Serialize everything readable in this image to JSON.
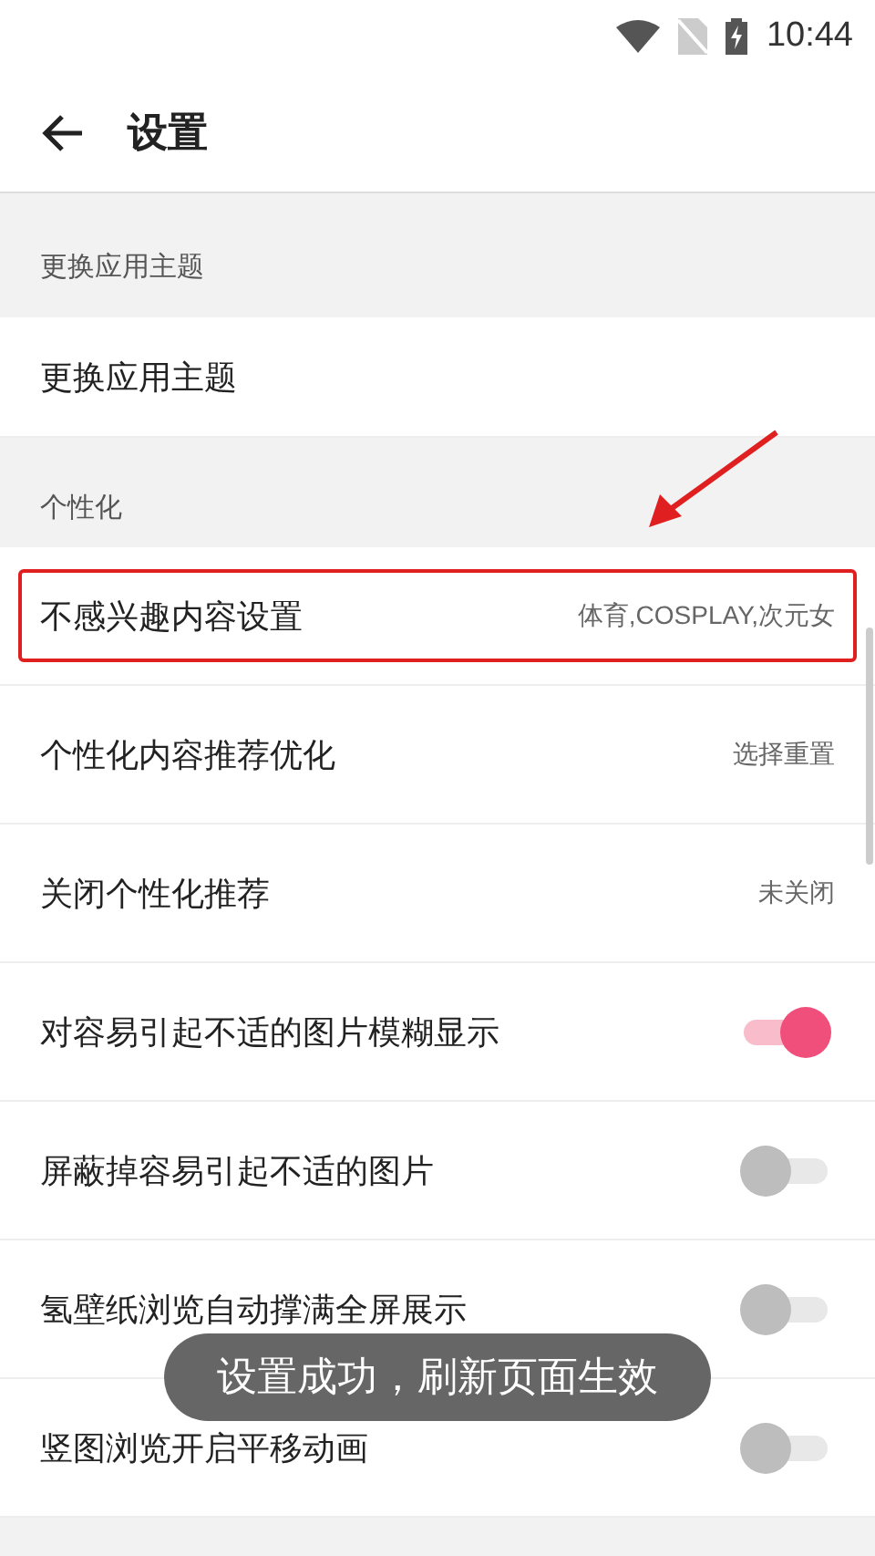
{
  "status_bar": {
    "time": "10:44"
  },
  "app_bar": {
    "title": "设置"
  },
  "sections": [
    {
      "header": "更换应用主题",
      "items": [
        {
          "kind": "nav",
          "label": "更换应用主题",
          "highlighted": false
        }
      ]
    },
    {
      "header": "个性化",
      "items": [
        {
          "kind": "nav",
          "label": "不感兴趣内容设置",
          "value": "体育,COSPLAY,次元女",
          "highlighted": true
        },
        {
          "kind": "nav",
          "label": "个性化内容推荐优化",
          "value": "选择重置",
          "highlighted": false
        },
        {
          "kind": "nav",
          "label": "关闭个性化推荐",
          "value": "未关闭",
          "highlighted": false
        },
        {
          "kind": "toggle",
          "label": "对容易引起不适的图片模糊显示",
          "on": true
        },
        {
          "kind": "toggle",
          "label": "屏蔽掉容易引起不适的图片",
          "on": false
        },
        {
          "kind": "toggle",
          "label": "氢壁纸浏览自动撑满全屏展示",
          "on": false
        },
        {
          "kind": "toggle",
          "label": "竖图浏览开启平移动画",
          "on": false
        }
      ]
    }
  ],
  "toast": {
    "text": "设置成功，刷新页面生效"
  }
}
